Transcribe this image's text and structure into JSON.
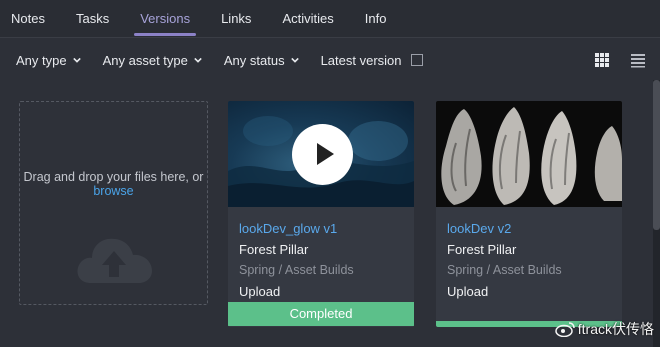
{
  "tabs": [
    {
      "label": "Notes",
      "active": false
    },
    {
      "label": "Tasks",
      "active": false
    },
    {
      "label": "Versions",
      "active": true
    },
    {
      "label": "Links",
      "active": false
    },
    {
      "label": "Activities",
      "active": false
    },
    {
      "label": "Info",
      "active": false
    }
  ],
  "filters": {
    "type": "Any type",
    "asset_type": "Any asset type",
    "status": "Any status",
    "latest_version": "Latest version",
    "latest_version_checked": false
  },
  "view_toggle": {
    "grid_icon": "grid-view-icon",
    "list_icon": "list-view-icon"
  },
  "dropzone": {
    "text": "Drag and drop your files here, or ",
    "link": "browse",
    "icon": "cloud-upload-icon"
  },
  "versions": [
    {
      "name": "lookDev_glow v1",
      "entity": "Forest Pillar",
      "path": "Spring / Asset Builds",
      "action": "Upload",
      "status": "Completed",
      "thumbnail": "video",
      "play_icon": "play-icon"
    },
    {
      "name": "lookDev v2",
      "entity": "Forest Pillar",
      "path": "Spring / Asset Builds",
      "action": "Upload",
      "status": "",
      "thumbnail": "image"
    }
  ],
  "watermark": "ftrack伏传恪",
  "colors": {
    "accent": "#8c82c7",
    "link": "#4aa3e8",
    "completed": "#5cc08a",
    "background": "#2d3038"
  }
}
